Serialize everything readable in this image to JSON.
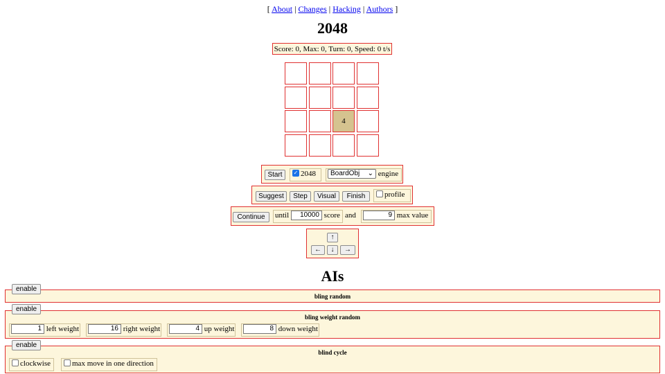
{
  "nav": {
    "open": "[",
    "close": "]",
    "sep": "|",
    "links": [
      "About",
      "Changes",
      "Hacking",
      "Authors"
    ]
  },
  "title": "2048",
  "status": "Score: 0, Max: 0, Turn: 0, Speed: 0 t/s",
  "board": [
    [
      "",
      "",
      "",
      ""
    ],
    [
      "",
      "",
      "",
      ""
    ],
    [
      "",
      "",
      "4",
      ""
    ],
    [
      "",
      "",
      "",
      ""
    ]
  ],
  "colors": {
    "accent_border": "#e03030",
    "panel_bg": "#fdf6dc",
    "tile_4": "#d5c38f"
  },
  "controls": {
    "start": "Start",
    "target_2048": {
      "label": "2048",
      "checked": true
    },
    "engine_select": "BoardObj",
    "engine_label": "engine",
    "suggest": "Suggest",
    "step": "Step",
    "visual": "Visual",
    "finish": "Finish",
    "profile": {
      "label": "profile",
      "checked": false
    },
    "continue": "Continue",
    "until_label": "until",
    "score_value": "10000",
    "score_label": "score",
    "and_label": "and",
    "max_value": "9",
    "max_label": "max value"
  },
  "arrows": {
    "up": "↑",
    "left": "←",
    "down": "↓",
    "right": "→"
  },
  "ais_heading": "AIs",
  "ais": [
    {
      "enable": "enable",
      "name": "bling random"
    },
    {
      "enable": "enable",
      "name": "bling weight random",
      "weights": [
        {
          "value": "1",
          "label": "left weight"
        },
        {
          "value": "16",
          "label": "right weight"
        },
        {
          "value": "4",
          "label": "up weight"
        },
        {
          "value": "8",
          "label": "down weight"
        }
      ]
    },
    {
      "enable": "enable",
      "name": "blind cycle",
      "options": [
        {
          "label": "clockwise",
          "checked": false
        },
        {
          "label": "max move in one direction",
          "checked": false
        }
      ]
    }
  ]
}
